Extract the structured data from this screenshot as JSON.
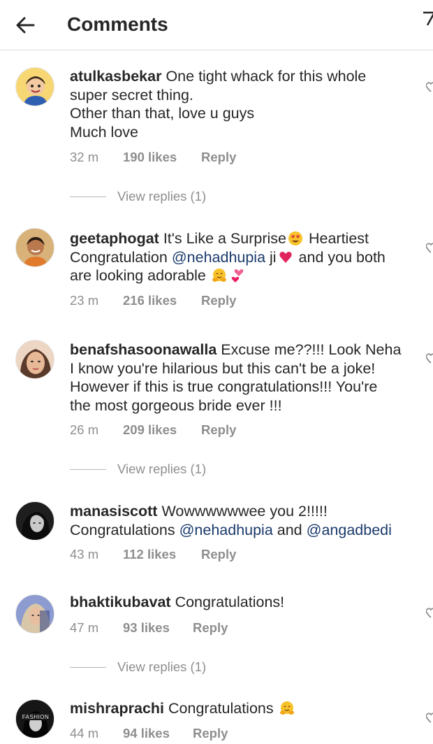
{
  "header": {
    "title": "Comments"
  },
  "colors": {
    "text": "#262626",
    "muted": "#8e8e8e",
    "mention": "#1a3a6b",
    "divider": "#dbdbdb"
  },
  "comments": [
    {
      "username": "atulkasbekar",
      "text_lines": [
        "One tight whack for this whole",
        "super secret thing.",
        "Other than that, love u guys",
        "Much love"
      ],
      "time": "32 m",
      "likes": "190 likes",
      "reply": "Reply",
      "view_replies": "View replies (1)"
    },
    {
      "username": "geetaphogat",
      "text_a": "It's Like a Surprise",
      "text_b": " Heartiest",
      "text_c": "Congratulation ",
      "mention": "@nehadhupia",
      "text_d": " ji",
      "text_e": " and you both",
      "text_f": "are looking adorable ",
      "emojis": [
        "heart-eyes-emoji",
        "heart-emoji",
        "hugging-emoji",
        "two-hearts-emoji"
      ],
      "time": "23 m",
      "likes": "216 likes",
      "reply": "Reply"
    },
    {
      "username": "benafshasoonawalla",
      "text_lines": [
        "Excuse me??!!! Look Neha",
        "I know you're hilarious but this can't be a joke!",
        "However if this is true congratulations!!! You're",
        "the most gorgeous bride ever !!!"
      ],
      "time": "26 m",
      "likes": "209 likes",
      "reply": "Reply",
      "view_replies": "View replies (1)"
    },
    {
      "username": "manasiscott",
      "text_a": "Wowwwwwwee you 2!!!!!",
      "text_b": "Congratulations ",
      "mention_1": "@nehadhupia",
      "text_c": " and ",
      "mention_2": "@angadbedi",
      "time": "43 m",
      "likes": "112 likes",
      "reply": "Reply"
    },
    {
      "username": "bhaktikubavat",
      "text_a": "Congratulations!",
      "time": "47 m",
      "likes": "93 likes",
      "reply": "Reply",
      "view_replies": "View replies (1)"
    },
    {
      "username": "mishraprachi",
      "text_a": "Congratulations ",
      "avatar_text": "FASHION",
      "time": "44 m",
      "likes": "94 likes",
      "reply": "Reply"
    }
  ]
}
